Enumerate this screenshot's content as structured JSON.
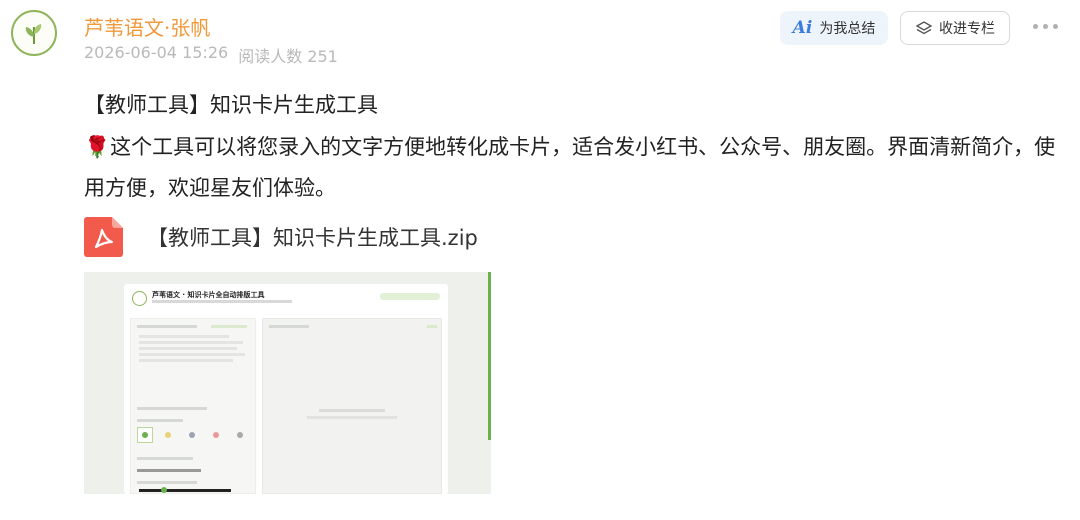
{
  "author": {
    "name": "芦苇语文·张帆"
  },
  "meta": {
    "time": "2026-06-04 15:26",
    "reads": "阅读人数 251"
  },
  "actions": {
    "ai_label": "为我总结",
    "ai_glyph": "Ai",
    "fav_label": "收进专栏"
  },
  "post": {
    "title": "【教师工具】知识卡片生成工具",
    "emoji": "🌹",
    "description": "这个工具可以将您录入的文字方便地转化成卡片，适合发小红书、公众号、朋友圈。界面清新简介，使用方便，欢迎星友们体验。"
  },
  "attachment": {
    "name": "【教师工具】知识卡片生成工具.zip",
    "icon": "pdf-file-icon"
  },
  "preview": {
    "card_title": "芦苇语文 · 知识卡片全自动排版工具"
  },
  "colors": {
    "author": "#f0993a",
    "accent_green": "#6ab04c",
    "pdf_red": "#f25a4c",
    "ai_blue": "#3a7be0"
  }
}
